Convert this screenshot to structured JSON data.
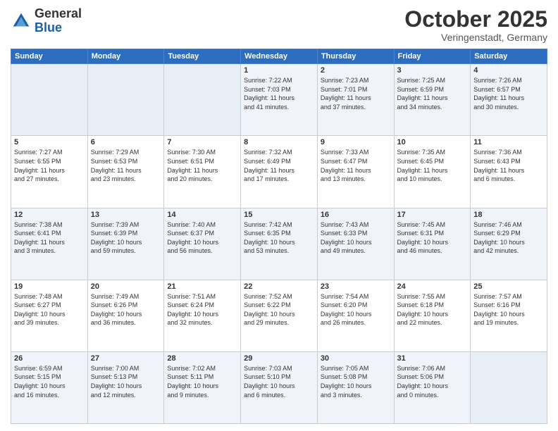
{
  "logo": {
    "general": "General",
    "blue": "Blue"
  },
  "header": {
    "month": "October 2025",
    "location": "Veringenstadt, Germany"
  },
  "weekdays": [
    "Sunday",
    "Monday",
    "Tuesday",
    "Wednesday",
    "Thursday",
    "Friday",
    "Saturday"
  ],
  "weeks": [
    [
      {
        "day": "",
        "info": ""
      },
      {
        "day": "",
        "info": ""
      },
      {
        "day": "",
        "info": ""
      },
      {
        "day": "1",
        "info": "Sunrise: 7:22 AM\nSunset: 7:03 PM\nDaylight: 11 hours\nand 41 minutes."
      },
      {
        "day": "2",
        "info": "Sunrise: 7:23 AM\nSunset: 7:01 PM\nDaylight: 11 hours\nand 37 minutes."
      },
      {
        "day": "3",
        "info": "Sunrise: 7:25 AM\nSunset: 6:59 PM\nDaylight: 11 hours\nand 34 minutes."
      },
      {
        "day": "4",
        "info": "Sunrise: 7:26 AM\nSunset: 6:57 PM\nDaylight: 11 hours\nand 30 minutes."
      }
    ],
    [
      {
        "day": "5",
        "info": "Sunrise: 7:27 AM\nSunset: 6:55 PM\nDaylight: 11 hours\nand 27 minutes."
      },
      {
        "day": "6",
        "info": "Sunrise: 7:29 AM\nSunset: 6:53 PM\nDaylight: 11 hours\nand 23 minutes."
      },
      {
        "day": "7",
        "info": "Sunrise: 7:30 AM\nSunset: 6:51 PM\nDaylight: 11 hours\nand 20 minutes."
      },
      {
        "day": "8",
        "info": "Sunrise: 7:32 AM\nSunset: 6:49 PM\nDaylight: 11 hours\nand 17 minutes."
      },
      {
        "day": "9",
        "info": "Sunrise: 7:33 AM\nSunset: 6:47 PM\nDaylight: 11 hours\nand 13 minutes."
      },
      {
        "day": "10",
        "info": "Sunrise: 7:35 AM\nSunset: 6:45 PM\nDaylight: 11 hours\nand 10 minutes."
      },
      {
        "day": "11",
        "info": "Sunrise: 7:36 AM\nSunset: 6:43 PM\nDaylight: 11 hours\nand 6 minutes."
      }
    ],
    [
      {
        "day": "12",
        "info": "Sunrise: 7:38 AM\nSunset: 6:41 PM\nDaylight: 11 hours\nand 3 minutes."
      },
      {
        "day": "13",
        "info": "Sunrise: 7:39 AM\nSunset: 6:39 PM\nDaylight: 10 hours\nand 59 minutes."
      },
      {
        "day": "14",
        "info": "Sunrise: 7:40 AM\nSunset: 6:37 PM\nDaylight: 10 hours\nand 56 minutes."
      },
      {
        "day": "15",
        "info": "Sunrise: 7:42 AM\nSunset: 6:35 PM\nDaylight: 10 hours\nand 53 minutes."
      },
      {
        "day": "16",
        "info": "Sunrise: 7:43 AM\nSunset: 6:33 PM\nDaylight: 10 hours\nand 49 minutes."
      },
      {
        "day": "17",
        "info": "Sunrise: 7:45 AM\nSunset: 6:31 PM\nDaylight: 10 hours\nand 46 minutes."
      },
      {
        "day": "18",
        "info": "Sunrise: 7:46 AM\nSunset: 6:29 PM\nDaylight: 10 hours\nand 42 minutes."
      }
    ],
    [
      {
        "day": "19",
        "info": "Sunrise: 7:48 AM\nSunset: 6:27 PM\nDaylight: 10 hours\nand 39 minutes."
      },
      {
        "day": "20",
        "info": "Sunrise: 7:49 AM\nSunset: 6:26 PM\nDaylight: 10 hours\nand 36 minutes."
      },
      {
        "day": "21",
        "info": "Sunrise: 7:51 AM\nSunset: 6:24 PM\nDaylight: 10 hours\nand 32 minutes."
      },
      {
        "day": "22",
        "info": "Sunrise: 7:52 AM\nSunset: 6:22 PM\nDaylight: 10 hours\nand 29 minutes."
      },
      {
        "day": "23",
        "info": "Sunrise: 7:54 AM\nSunset: 6:20 PM\nDaylight: 10 hours\nand 26 minutes."
      },
      {
        "day": "24",
        "info": "Sunrise: 7:55 AM\nSunset: 6:18 PM\nDaylight: 10 hours\nand 22 minutes."
      },
      {
        "day": "25",
        "info": "Sunrise: 7:57 AM\nSunset: 6:16 PM\nDaylight: 10 hours\nand 19 minutes."
      }
    ],
    [
      {
        "day": "26",
        "info": "Sunrise: 6:59 AM\nSunset: 5:15 PM\nDaylight: 10 hours\nand 16 minutes."
      },
      {
        "day": "27",
        "info": "Sunrise: 7:00 AM\nSunset: 5:13 PM\nDaylight: 10 hours\nand 12 minutes."
      },
      {
        "day": "28",
        "info": "Sunrise: 7:02 AM\nSunset: 5:11 PM\nDaylight: 10 hours\nand 9 minutes."
      },
      {
        "day": "29",
        "info": "Sunrise: 7:03 AM\nSunset: 5:10 PM\nDaylight: 10 hours\nand 6 minutes."
      },
      {
        "day": "30",
        "info": "Sunrise: 7:05 AM\nSunset: 5:08 PM\nDaylight: 10 hours\nand 3 minutes."
      },
      {
        "day": "31",
        "info": "Sunrise: 7:06 AM\nSunset: 5:06 PM\nDaylight: 10 hours\nand 0 minutes."
      },
      {
        "day": "",
        "info": ""
      }
    ]
  ]
}
